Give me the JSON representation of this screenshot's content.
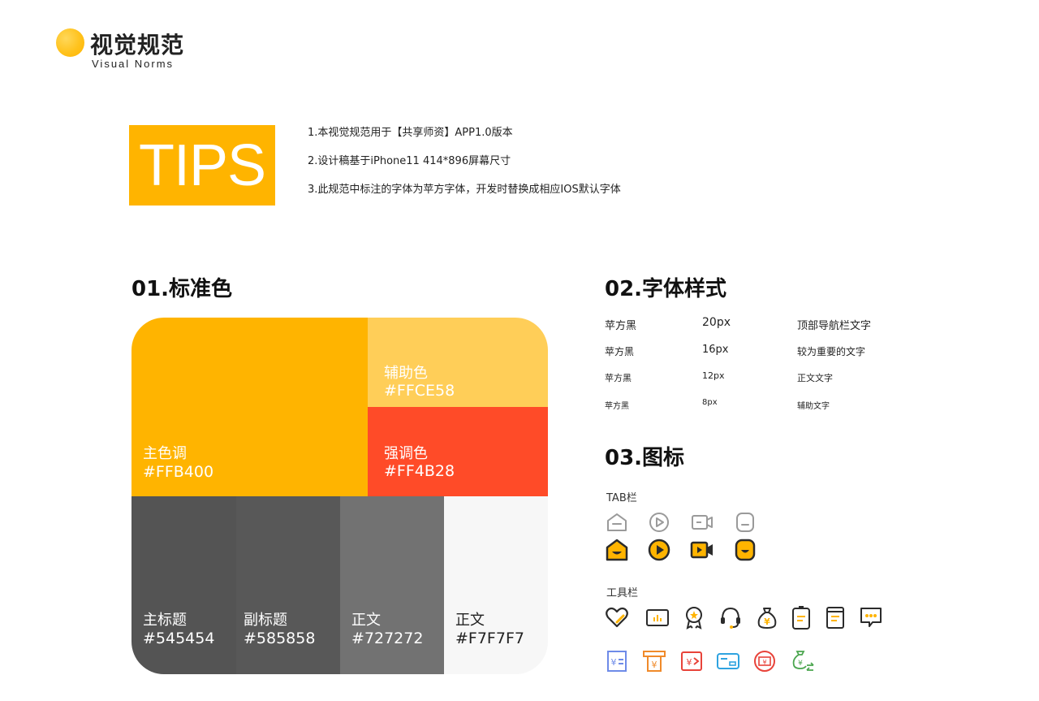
{
  "header": {
    "title": "视觉规范",
    "subtitle": "Visual Norms"
  },
  "tips": {
    "badge": "TIPS",
    "lines": [
      "1.本视觉规范用于【共享师资】APP1.0版本",
      "2.设计稿基于iPhone11 414*896屏幕尺寸",
      "3.此规范中标注的字体为苹方字体，开发时替换成相应IOS默认字体"
    ]
  },
  "colors": {
    "title": "01.标准色",
    "primary": {
      "name": "主色调",
      "hex": "#FFB400"
    },
    "auxiliary": {
      "name": "辅助色",
      "hex": "#FFCE58"
    },
    "accent": {
      "name": "强调色",
      "hex": "#FF4B28"
    },
    "grays": [
      {
        "name": "主标题",
        "hex": "#545454"
      },
      {
        "name": "副标题",
        "hex": "#585858"
      },
      {
        "name": "正文",
        "hex": "#727272"
      },
      {
        "name": "正文",
        "hex": "#F7F7F7"
      }
    ]
  },
  "fonts": {
    "title": "02.字体样式",
    "rows": [
      {
        "family": "苹方黑",
        "size": "20px",
        "usage": "顶部导航栏文字"
      },
      {
        "family": "苹方黑",
        "size": "16px",
        "usage": "较为重要的文字"
      },
      {
        "family": "苹方黑",
        "size": "12px",
        "usage": "正文文字"
      },
      {
        "family": "苹方黑",
        "size": "8px",
        "usage": "辅助文字"
      }
    ]
  },
  "icons": {
    "title": "03.图标",
    "tab_label": "TAB栏",
    "tool_label": "工具栏",
    "tab_icons": [
      "home-icon",
      "play-icon",
      "video-icon",
      "profile-icon"
    ],
    "tool_icons": [
      "heart-icon",
      "chart-icon",
      "medal-icon",
      "headset-icon",
      "money-bag-icon",
      "battery-doc-icon",
      "document-icon",
      "chat-icon"
    ],
    "colored_icons": [
      "receipt-icon",
      "atm-withdraw-icon",
      "exchange-icon",
      "card-icon",
      "coupon-icon",
      "money-transfer-icon"
    ],
    "accent_color": "#FFB400",
    "dark_color": "#2b2b2b",
    "gray_color": "#999999"
  }
}
